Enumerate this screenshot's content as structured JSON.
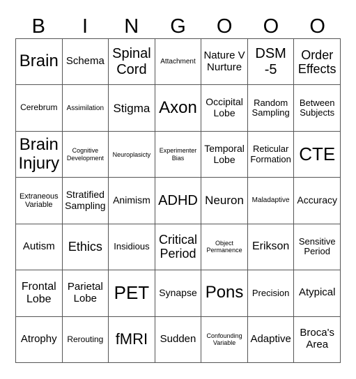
{
  "header": {
    "letters": [
      "B",
      "I",
      "N",
      "G",
      "O",
      "O",
      "O"
    ]
  },
  "board": {
    "rows": [
      [
        "Brain",
        "Schema",
        "Spinal Cord",
        "Attachment",
        "Nature V Nurture",
        "DSM-5",
        "Order Effects"
      ],
      [
        "Cerebrum",
        "Assimilation",
        "Stigma",
        "Axon",
        "Occipital Lobe",
        "Random Sampling",
        "Between Subjects"
      ],
      [
        "Brain Injury",
        "Cognitive Development",
        "Neuroplasicty",
        "Experimenter Bias",
        "Temporal Lobe",
        "Reticular Formation",
        "CTE"
      ],
      [
        "Extraneous Variable",
        "Stratified Sampling",
        "Animism",
        "ADHD",
        "Neuron",
        "Maladaptive",
        "Accuracy"
      ],
      [
        "Autism",
        "Ethics",
        "Insidious",
        "Critical Period",
        "Object Permanence",
        "Erikson",
        "Sensitive Period"
      ],
      [
        "Frontal Lobe",
        "Parietal Lobe",
        "PET",
        "Synapse",
        "Pons",
        "Precision",
        "Atypical"
      ],
      [
        "Atrophy",
        "Rerouting",
        "fMRI",
        "Sudden",
        "Confounding Variable",
        "Adaptive",
        "Broca's Area"
      ]
    ]
  }
}
